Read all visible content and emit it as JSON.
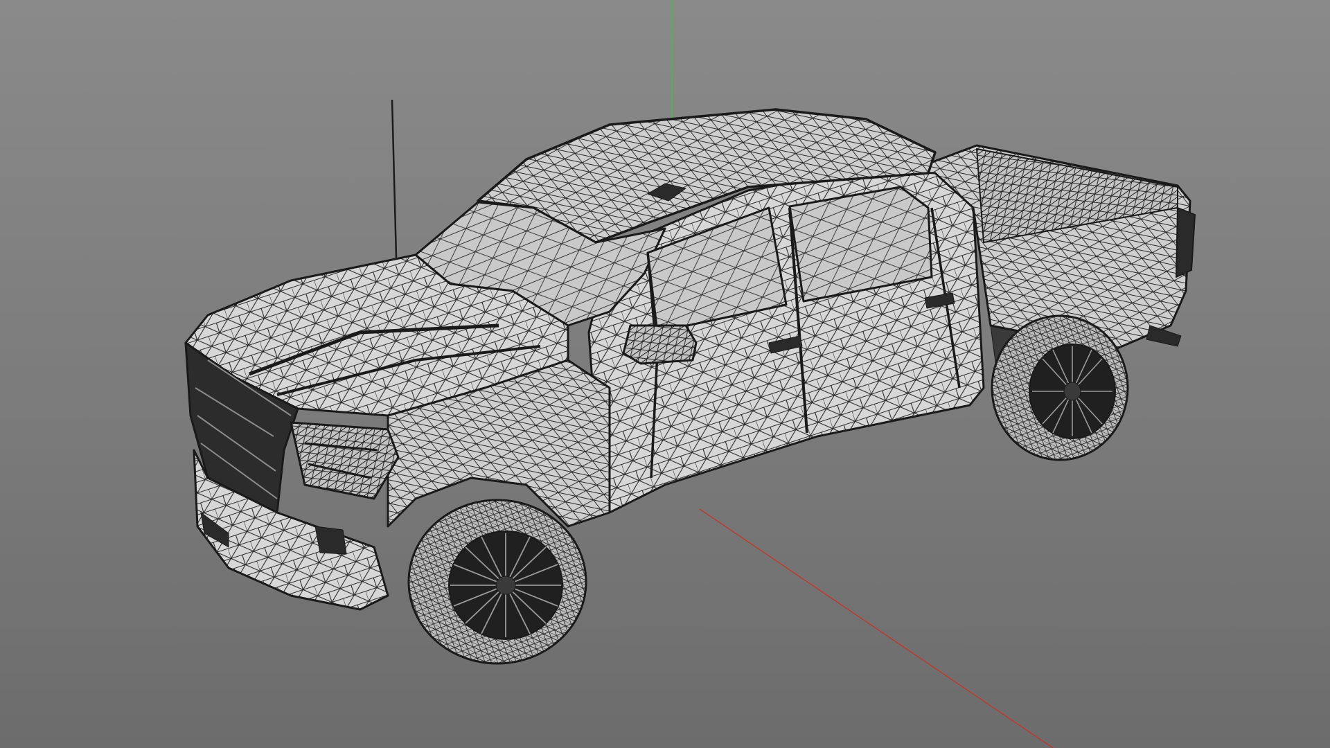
{
  "viewport": {
    "background_top": "#8a8a8a",
    "background_bottom": "#6c6c6c"
  },
  "axes": {
    "x_color": "#c0392b",
    "y_color": "#3fbf3f"
  },
  "model": {
    "render_mode": "wireframe",
    "subject": "pickup-truck",
    "wire_color": "#1e1e1e",
    "fill_color": "#d9d9d9"
  }
}
